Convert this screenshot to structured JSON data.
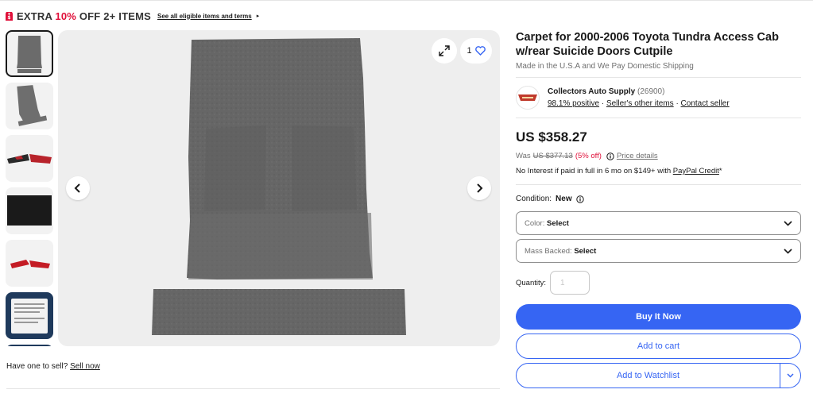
{
  "promo": {
    "prefix": "EXTRA ",
    "percent": "10%",
    "suffix": " OFF 2+ ITEMS",
    "link": "See all eligible items and terms",
    "arrow": "▸"
  },
  "gallery": {
    "watch_count": "1"
  },
  "thumbnails": [
    {
      "name": "thumb-gray-carpet"
    },
    {
      "name": "thumb-gray-carpet-angled"
    },
    {
      "name": "thumb-red-black-carpet"
    },
    {
      "name": "thumb-black-swatch"
    },
    {
      "name": "thumb-red-carpet"
    },
    {
      "name": "thumb-info-card"
    }
  ],
  "sell": {
    "prompt": "Have one to sell?",
    "link": "Sell now"
  },
  "product": {
    "title": "Carpet for 2000-2006 Toyota Tundra Access Cab w/rear Suicide Doors Cutpile",
    "subtitle": "Made in the U.S.A and We Pay Domestic Shipping"
  },
  "seller": {
    "name": "Collectors Auto Supply",
    "score": "(26900)",
    "positive": "98.1% positive",
    "other_items": "Seller's other items",
    "contact": "Contact seller"
  },
  "pricing": {
    "price": "US $358.27",
    "was_label": "Was",
    "was_price": "US $377.13",
    "off": "(5% off)",
    "details": "Price details",
    "credit_text": "No Interest if paid in full in 6 mo on $149+ with",
    "credit_link": "PayPal Credit",
    "credit_suffix": "*"
  },
  "condition": {
    "label": "Condition:",
    "value": "New"
  },
  "selects": {
    "color_label": "Color:",
    "color_value": "Select",
    "mass_label": "Mass Backed:",
    "mass_value": "Select"
  },
  "quantity": {
    "label": "Quantity:",
    "value": "1"
  },
  "buttons": {
    "buy": "Buy It Now",
    "cart": "Add to cart",
    "watchlist": "Add to Watchlist"
  },
  "colors": {
    "accent": "#3665f3",
    "sale": "#e0103a"
  }
}
